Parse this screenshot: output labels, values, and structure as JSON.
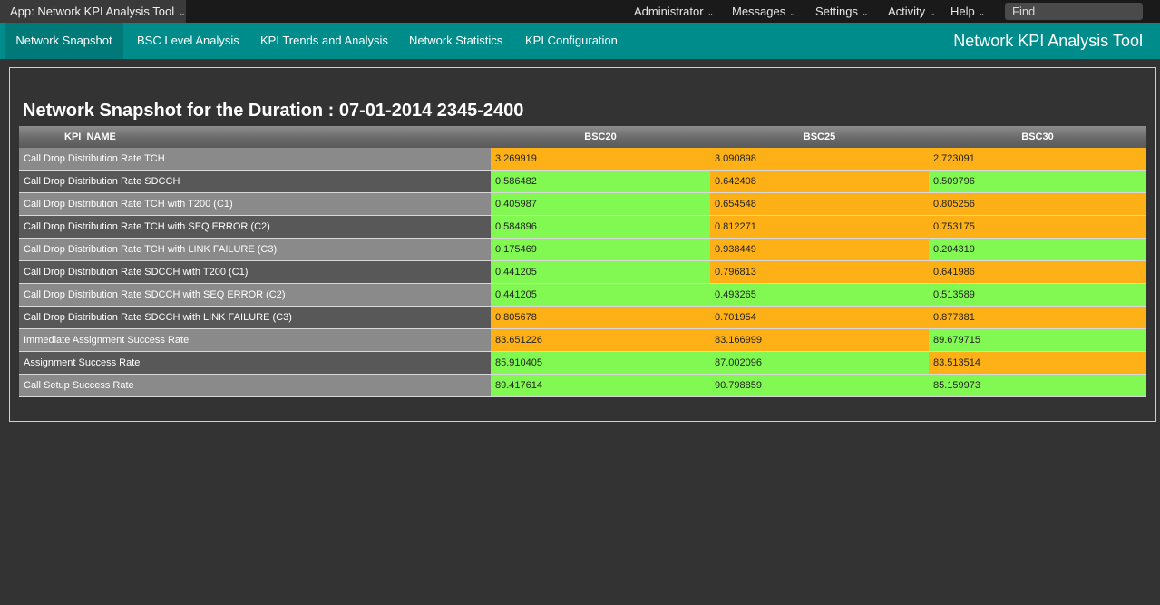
{
  "topbar": {
    "app_picker_label": "App: Network KPI Analysis Tool",
    "menus": {
      "administrator": "Administrator",
      "messages": "Messages",
      "settings": "Settings",
      "activity": "Activity",
      "help": "Help"
    },
    "find_placeholder": "Find"
  },
  "nav": {
    "tabs": [
      {
        "label": "Network Snapshot",
        "active": true
      },
      {
        "label": "BSC Level Analysis",
        "active": false
      },
      {
        "label": "KPI Trends and Analysis",
        "active": false
      },
      {
        "label": "Network Statistics",
        "active": false
      },
      {
        "label": "KPI Configuration",
        "active": false
      }
    ],
    "app_title": "Network KPI Analysis Tool"
  },
  "main": {
    "page_title": "Network Snapshot for the Duration : 07-01-2014 2345-2400"
  },
  "table": {
    "headers": {
      "kpi_name": "KPI_NAME",
      "bsc20": "BSC20",
      "bsc25": "BSC25",
      "bsc30": "BSC30"
    },
    "status_colors": {
      "warn": "#fdb117",
      "ok": "#82f952"
    },
    "rows": [
      {
        "name": "Call Drop Distribution Rate TCH",
        "values": [
          "3.269919",
          "3.090898",
          "2.723091"
        ],
        "status": [
          "warn",
          "warn",
          "warn"
        ]
      },
      {
        "name": "Call Drop Distribution Rate SDCCH",
        "values": [
          "0.586482",
          "0.642408",
          "0.509796"
        ],
        "status": [
          "ok",
          "warn",
          "ok"
        ]
      },
      {
        "name": "Call Drop Distribution Rate TCH with T200 (C1)",
        "values": [
          "0.405987",
          "0.654548",
          "0.805256"
        ],
        "status": [
          "ok",
          "warn",
          "warn"
        ]
      },
      {
        "name": "Call Drop Distribution Rate TCH with SEQ ERROR (C2)",
        "values": [
          "0.584896",
          "0.812271",
          "0.753175"
        ],
        "status": [
          "ok",
          "warn",
          "warn"
        ]
      },
      {
        "name": "Call Drop Distribution Rate TCH with LINK FAILURE (C3)",
        "values": [
          "0.175469",
          "0.938449",
          "0.204319"
        ],
        "status": [
          "ok",
          "warn",
          "ok"
        ]
      },
      {
        "name": "Call Drop Distribution Rate SDCCH with T200 (C1)",
        "values": [
          "0.441205",
          "0.796813",
          "0.641986"
        ],
        "status": [
          "ok",
          "warn",
          "warn"
        ]
      },
      {
        "name": "Call Drop Distribution Rate SDCCH with SEQ ERROR (C2)",
        "values": [
          "0.441205",
          "0.493265",
          "0.513589"
        ],
        "status": [
          "ok",
          "ok",
          "ok"
        ]
      },
      {
        "name": "Call Drop Distribution Rate SDCCH with LINK FAILURE (C3)",
        "values": [
          "0.805678",
          "0.701954",
          "0.877381"
        ],
        "status": [
          "warn",
          "warn",
          "warn"
        ]
      },
      {
        "name": "Immediate Assignment Success Rate",
        "values": [
          "83.651226",
          "83.166999",
          "89.679715"
        ],
        "status": [
          "warn",
          "warn",
          "ok"
        ]
      },
      {
        "name": "Assignment Success Rate",
        "values": [
          "85.910405",
          "87.002096",
          "83.513514"
        ],
        "status": [
          "ok",
          "ok",
          "warn"
        ]
      },
      {
        "name": "Call Setup Success Rate",
        "values": [
          "89.417614",
          "90.798859",
          "85.159973"
        ],
        "status": [
          "ok",
          "ok",
          "ok"
        ]
      }
    ]
  }
}
